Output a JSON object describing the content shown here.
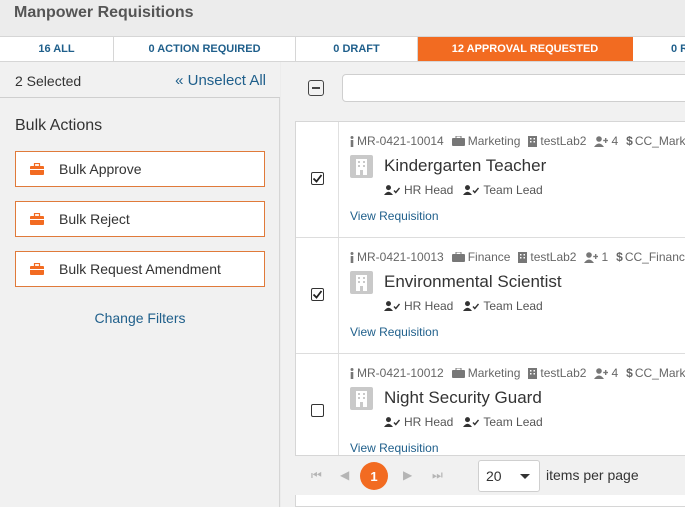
{
  "header": {
    "title": "Manpower Requisitions"
  },
  "tabs": [
    {
      "label": "16 ALL",
      "active": false
    },
    {
      "label": "0 ACTION REQUIRED",
      "active": false
    },
    {
      "label": "0 DRAFT",
      "active": false
    },
    {
      "label": "12 APPROVAL REQUESTED",
      "active": true
    },
    {
      "label": "0 R",
      "active": false
    }
  ],
  "sidebar": {
    "selected_count": "2 Selected",
    "unselect_all": "« Unselect All",
    "bulk_title": "Bulk Actions",
    "bulk_buttons": [
      {
        "label": "Bulk Approve",
        "icon": "briefcase-icon"
      },
      {
        "label": "Bulk Reject",
        "icon": "briefcase-icon"
      },
      {
        "label": "Bulk Request Amendment",
        "icon": "briefcase-icon"
      }
    ],
    "change_filters": "Change Filters"
  },
  "search": {
    "placeholder": ""
  },
  "requisitions": [
    {
      "id": "MR-0421-10014",
      "department": "Marketing",
      "lab": "testLab2",
      "count": "4",
      "cost_center": "CC_Mark",
      "title": "Kindergarten Teacher",
      "approvers": [
        "HR Head",
        "Team Lead"
      ],
      "link": "View Requisition",
      "checked": true
    },
    {
      "id": "MR-0421-10013",
      "department": "Finance",
      "lab": "testLab2",
      "count": "1",
      "cost_center": "CC_Financ",
      "title": "Environmental Scientist",
      "approvers": [
        "HR Head",
        "Team Lead"
      ],
      "link": "View Requisition",
      "checked": true
    },
    {
      "id": "MR-0421-10012",
      "department": "Marketing",
      "lab": "testLab2",
      "count": "4",
      "cost_center": "CC_Mark",
      "title": "Night Security Guard",
      "approvers": [
        "HR Head",
        "Team Lead"
      ],
      "link": "View Requisition",
      "checked": false
    }
  ],
  "pager": {
    "current_page": "1",
    "page_size": "20",
    "items_per_page": "items per page",
    "first": "⏮",
    "prev": "◀",
    "next": "▶",
    "last": "⏭"
  },
  "colors": {
    "accent": "#f26b21",
    "link": "#1f5f8b"
  }
}
